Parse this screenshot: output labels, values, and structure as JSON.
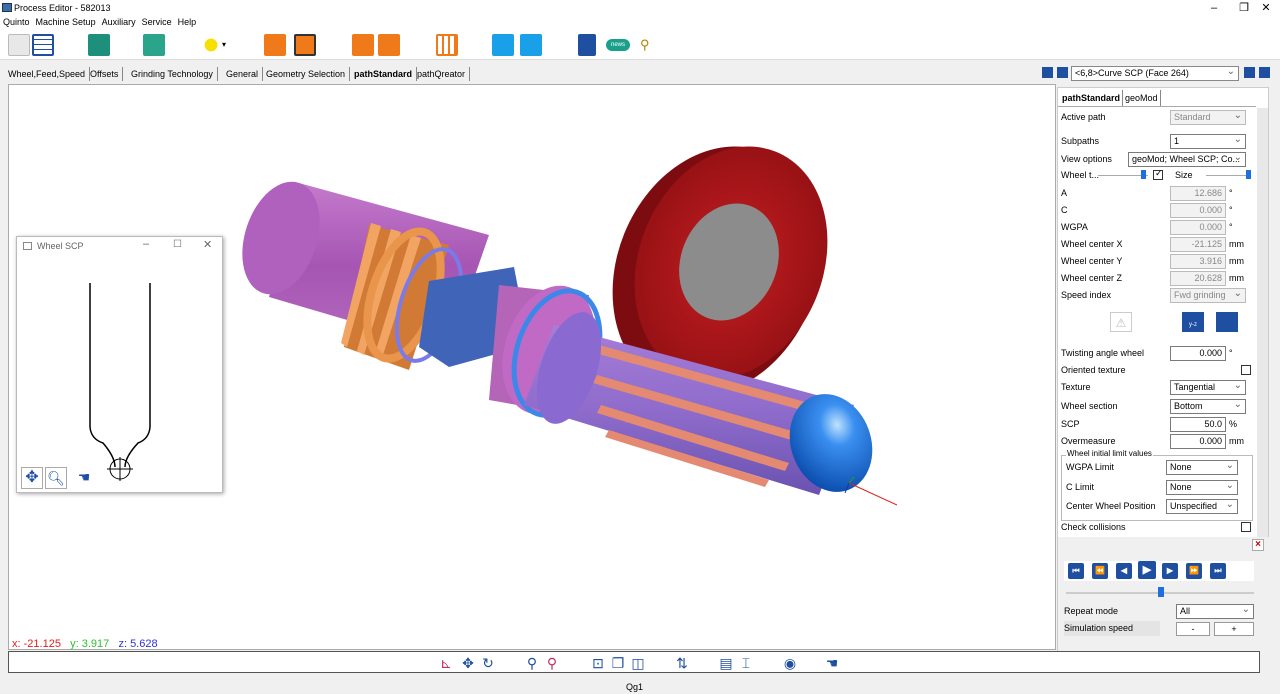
{
  "window": {
    "title": "Process Editor - 582013",
    "minimize": "–",
    "maximize": "❐",
    "close": "✕"
  },
  "menu": [
    "Quinto",
    "Machine Setup",
    "Auxiliary",
    "Service",
    "Help"
  ],
  "tabs": [
    {
      "label": "Wheel,Feed,Speed",
      "active": false
    },
    {
      "label": "Offsets",
      "active": false
    },
    {
      "label": "Grinding Technology",
      "active": false
    },
    {
      "label": "General",
      "active": false
    },
    {
      "label": "Geometry Selection",
      "active": false
    },
    {
      "label": "pathStandard",
      "active": true
    },
    {
      "label": "pathQreator",
      "active": false
    }
  ],
  "selector": {
    "value": "<6,8>Curve SCP (Face 264)"
  },
  "panel": {
    "tabs": [
      {
        "label": "pathStandard",
        "active": true
      },
      {
        "label": "geoMod",
        "active": false
      }
    ],
    "active_path": {
      "label": "Active path",
      "value": "Standard"
    },
    "subpaths": {
      "label": "Subpaths",
      "value": "1"
    },
    "view_options": {
      "label": "View options",
      "value": "geoMod; Wheel SCP; Co..."
    },
    "wheel_t": {
      "label": "Wheel t...",
      "checked": true,
      "size_label": "Size"
    },
    "a": {
      "label": "A",
      "value": "12.686",
      "unit": "°"
    },
    "c": {
      "label": "C",
      "value": "0.000",
      "unit": "°"
    },
    "wgpa": {
      "label": "WGPA",
      "value": "0.000",
      "unit": "°"
    },
    "wcx": {
      "label": "Wheel center X",
      "value": "-21.125",
      "unit": "mm"
    },
    "wcy": {
      "label": "Wheel center Y",
      "value": "3.916",
      "unit": "mm"
    },
    "wcz": {
      "label": "Wheel center Z",
      "value": "20.628",
      "unit": "mm"
    },
    "speed_index": {
      "label": "Speed index",
      "value": "Fwd grinding"
    },
    "twisting": {
      "label": "Twisting angle wheel",
      "value": "0.000",
      "unit": "°"
    },
    "oriented_texture": {
      "label": "Oriented texture",
      "checked": false
    },
    "texture": {
      "label": "Texture",
      "value": "Tangential"
    },
    "wheel_section": {
      "label": "Wheel section",
      "value": "Bottom"
    },
    "scp": {
      "label": "SCP",
      "value": "50.0",
      "unit": "%"
    },
    "overmeasure": {
      "label": "Overmeasure",
      "value": "0.000",
      "unit": "mm"
    },
    "limits": {
      "title": "Wheel initial limit values",
      "wgpa_limit": {
        "label": "WGPA Limit",
        "value": "None"
      },
      "c_limit": {
        "label": "C Limit",
        "value": "None"
      },
      "center_wheel": {
        "label": "Center Wheel Position",
        "value": "Unspecified"
      }
    },
    "check_collisions": {
      "label": "Check collisions",
      "checked": false
    },
    "close_label": "×",
    "repeat_mode": {
      "label": "Repeat mode",
      "value": "All"
    },
    "sim_speed": {
      "label": "Simulation speed",
      "minus": "-",
      "plus": "+"
    }
  },
  "coords": {
    "x_label": "x:",
    "x": "-21.125",
    "y_label": "y:",
    "y": "3.917",
    "z_label": "z:",
    "z": "5.628"
  },
  "scp_window": {
    "title": "Wheel SCP"
  },
  "status": {
    "text": "Qg1"
  },
  "colors": {
    "wheel": "#b3161a",
    "shaft": "#b75fbd",
    "thread": "#e08a3a",
    "blue": "#2b6fd6"
  }
}
